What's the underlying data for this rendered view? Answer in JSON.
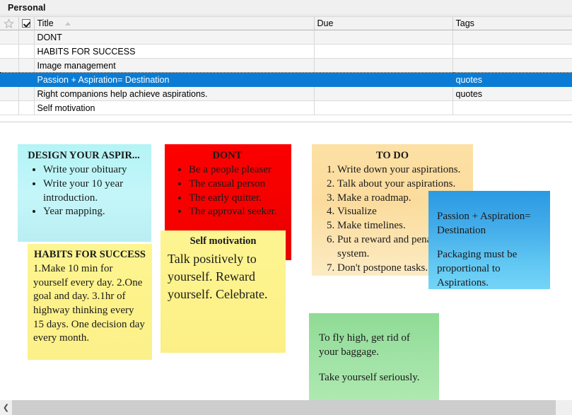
{
  "window": {
    "title": "Personal"
  },
  "table": {
    "columns": [
      {
        "key": "star",
        "label": "",
        "icon": "star-icon"
      },
      {
        "key": "check",
        "label": "",
        "icon": "checkbox-checked-icon"
      },
      {
        "key": "title",
        "label": "Title",
        "sort": "ascending"
      },
      {
        "key": "due",
        "label": "Due"
      },
      {
        "key": "tags",
        "label": "Tags"
      }
    ],
    "rows": [
      {
        "title": "DONT",
        "due": "",
        "tags": "",
        "state": "alt"
      },
      {
        "title": "HABITS FOR SUCCESS",
        "due": "",
        "tags": "",
        "state": "plain"
      },
      {
        "title": "Image management",
        "due": "",
        "tags": "",
        "state": "focus"
      },
      {
        "title": "Passion + Aspiration= Destination",
        "due": "",
        "tags": "quotes",
        "state": "selected"
      },
      {
        "title": "Right companions help achieve aspirations.",
        "due": "",
        "tags": "quotes",
        "state": "alt"
      },
      {
        "title": "Self motivation",
        "due": "",
        "tags": "",
        "state": "plain"
      }
    ]
  },
  "notes": {
    "design": {
      "title": "DESIGN YOUR ASPIR...",
      "items": [
        "Write your obituary",
        "Write your 10 year introduction.",
        "Year mapping."
      ],
      "color": "#b9f2f6"
    },
    "habits": {
      "title": "HABITS FOR SUCCESS",
      "body": "1.Make 10 min for yourself every day. 2.One goal and day. 3.1hr of highway thinking every 15 days. One decision day every month.",
      "color": "#fdf28a"
    },
    "dont": {
      "title": "DONT",
      "items": [
        "Be a people pleaser",
        "The casual person",
        "The early quitter.",
        "The approval seeker."
      ],
      "color": "#f60000"
    },
    "self_motivation": {
      "title": "Self motivation",
      "body": "Talk positively to yourself. Reward yourself. Celebrate.",
      "color": "#fdf28a"
    },
    "todo": {
      "title": "TO DO",
      "items": [
        "Write down your aspirations.",
        "Talk about your aspirations.",
        "Make a roadmap.",
        "Visualize",
        "Make timelines.",
        "Put a reward and penalty system.",
        "Don't postpone tasks."
      ],
      "color": "#fbdc9d"
    },
    "passion": {
      "line1": "Passion + Aspiration= Destination",
      "line2": "Packaging must be proportional to Aspirations.",
      "color": "#45aeea"
    },
    "green": {
      "line1": "To fly high, get rid of your baggage.",
      "line2": "Take yourself seriously.",
      "color": "#a0e2a5"
    }
  },
  "scrollbar": {
    "left_arrow": "❮"
  }
}
